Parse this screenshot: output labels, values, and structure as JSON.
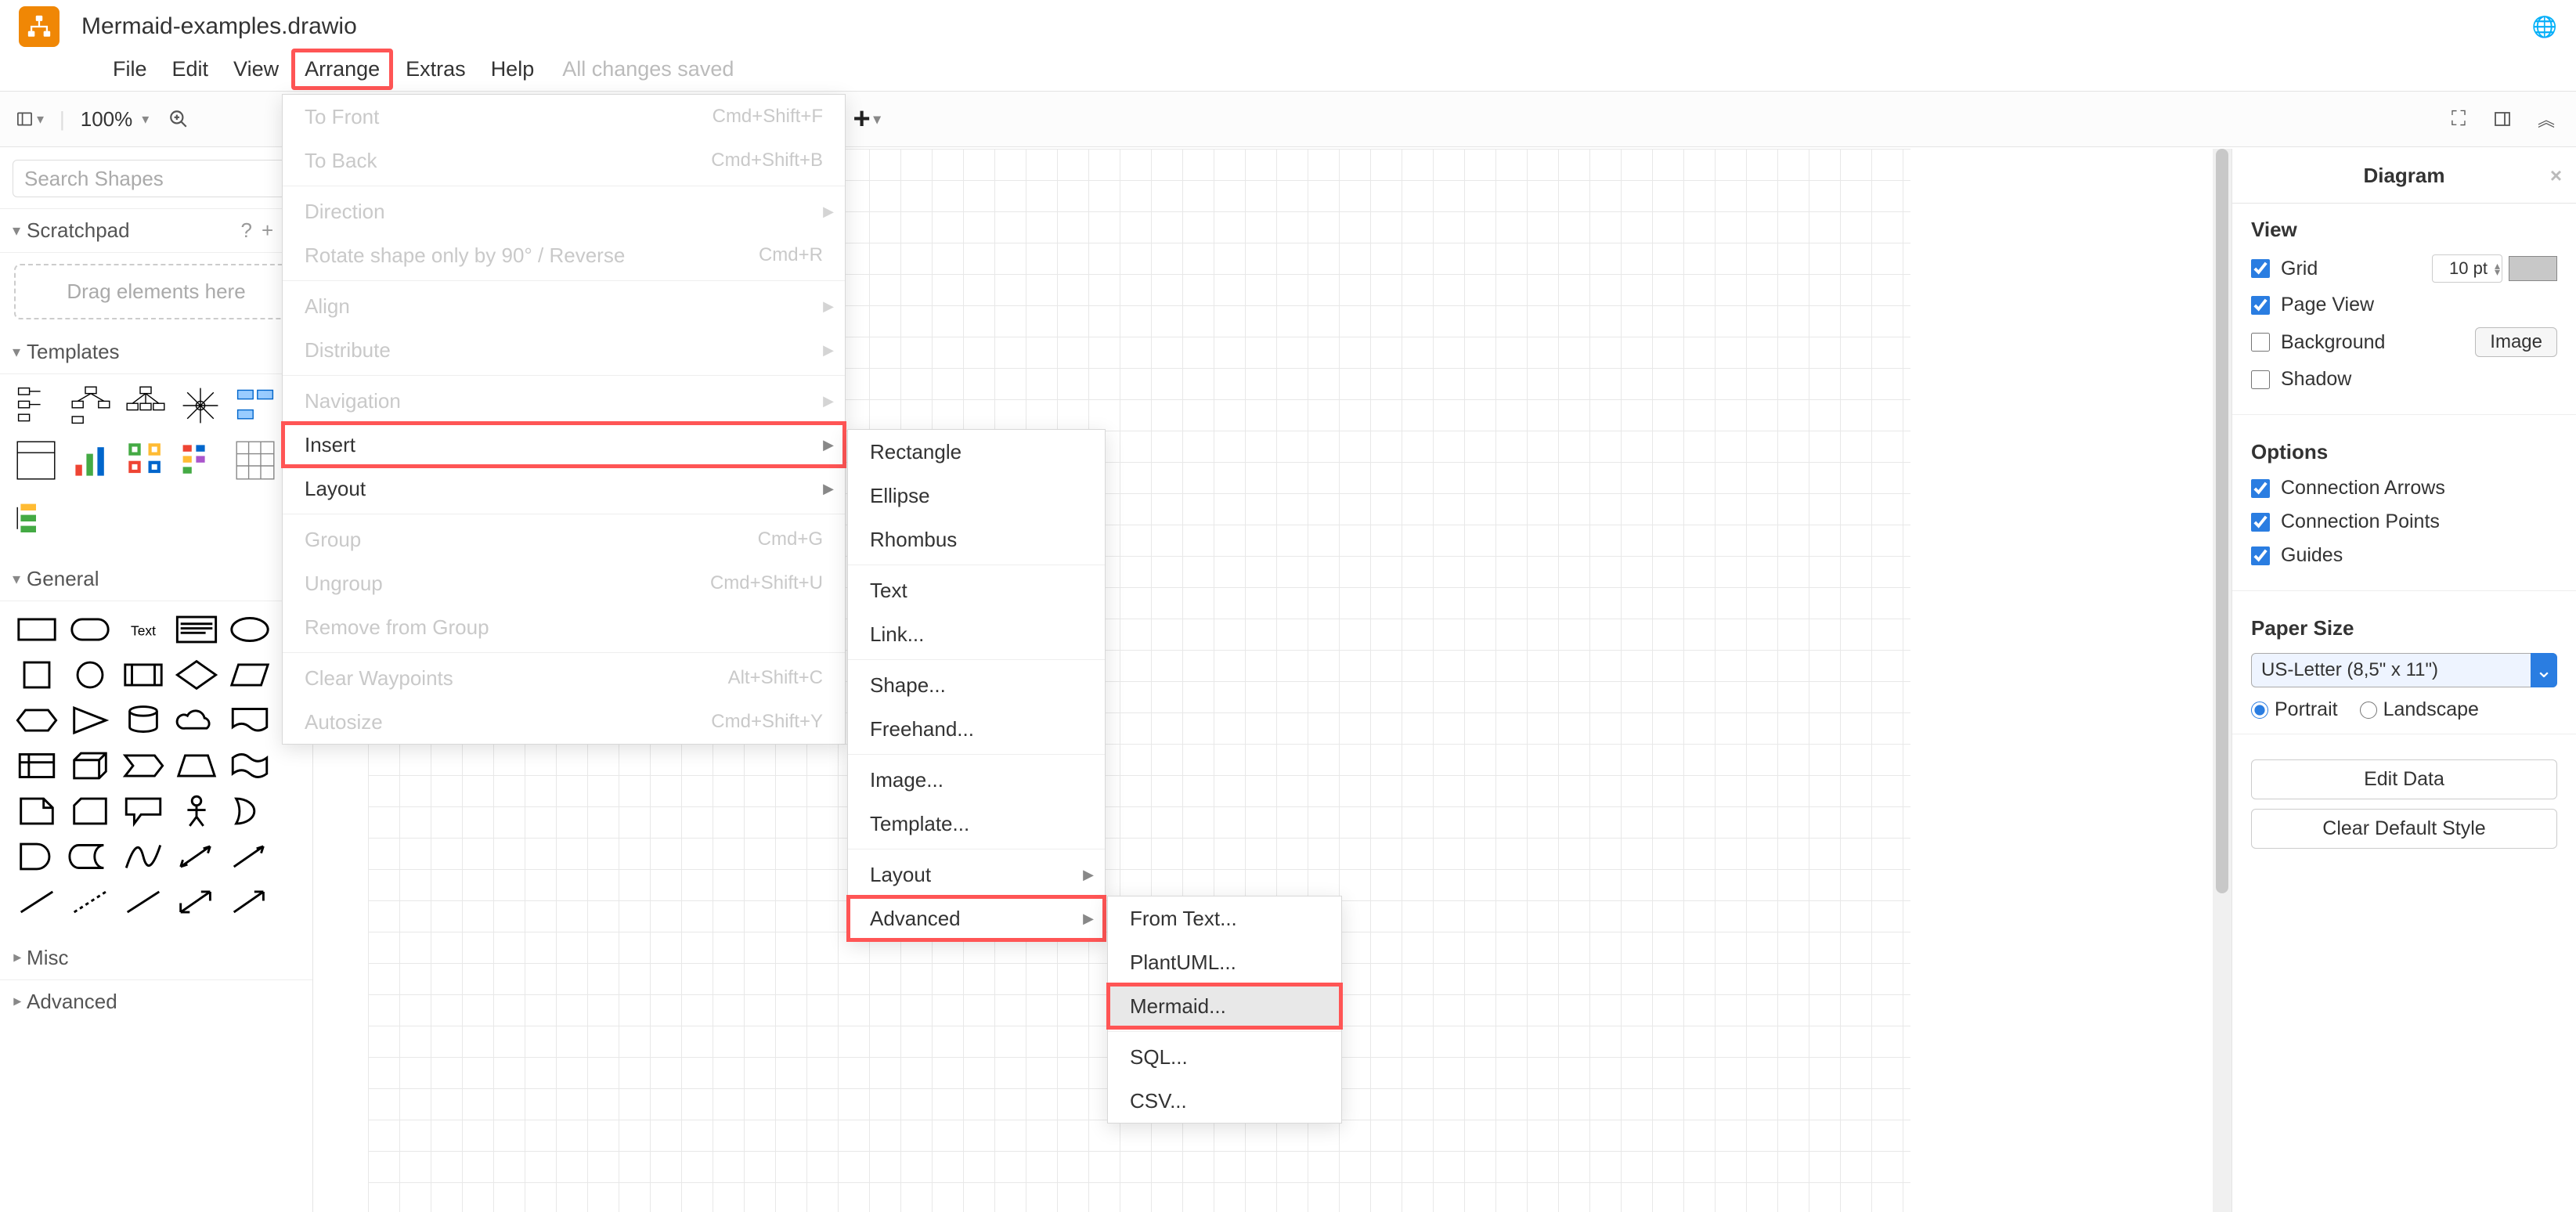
{
  "title": "Mermaid-examples.drawio",
  "menubar": {
    "items": [
      "File",
      "Edit",
      "View",
      "Arrange",
      "Extras",
      "Help"
    ],
    "highlighted": "Arrange",
    "status": "All changes saved"
  },
  "toolbar": {
    "zoom": "100%"
  },
  "left": {
    "search_placeholder": "Search Shapes",
    "scratchpad_label": "Scratchpad",
    "drag_hint": "Drag elements here",
    "templates_label": "Templates",
    "general_label": "General",
    "misc_label": "Misc",
    "advanced_label": "Advanced"
  },
  "arrange_menu": [
    {
      "label": "To Front",
      "sc": "Cmd+Shift+F",
      "disabled": true
    },
    {
      "label": "To Back",
      "sc": "Cmd+Shift+B",
      "disabled": true
    },
    {
      "sep": true
    },
    {
      "label": "Direction",
      "sub": true,
      "disabled": true
    },
    {
      "label": "Rotate shape only by 90° / Reverse",
      "sc": "Cmd+R",
      "disabled": true
    },
    {
      "sep": true
    },
    {
      "label": "Align",
      "sub": true,
      "disabled": true
    },
    {
      "label": "Distribute",
      "sub": true,
      "disabled": true
    },
    {
      "sep": true
    },
    {
      "label": "Navigation",
      "sub": true,
      "disabled": true
    },
    {
      "label": "Insert",
      "sub": true,
      "highlighted": true
    },
    {
      "label": "Layout",
      "sub": true
    },
    {
      "sep": true
    },
    {
      "label": "Group",
      "sc": "Cmd+G",
      "disabled": true
    },
    {
      "label": "Ungroup",
      "sc": "Cmd+Shift+U",
      "disabled": true
    },
    {
      "label": "Remove from Group",
      "disabled": true
    },
    {
      "sep": true
    },
    {
      "label": "Clear Waypoints",
      "sc": "Alt+Shift+C",
      "disabled": true
    },
    {
      "label": "Autosize",
      "sc": "Cmd+Shift+Y",
      "disabled": true
    }
  ],
  "insert_menu": [
    {
      "label": "Rectangle"
    },
    {
      "label": "Ellipse"
    },
    {
      "label": "Rhombus"
    },
    {
      "sep": true
    },
    {
      "label": "Text"
    },
    {
      "label": "Link..."
    },
    {
      "sep": true
    },
    {
      "label": "Shape..."
    },
    {
      "label": "Freehand..."
    },
    {
      "sep": true
    },
    {
      "label": "Image..."
    },
    {
      "label": "Template..."
    },
    {
      "sep": true
    },
    {
      "label": "Layout",
      "sub": true
    },
    {
      "label": "Advanced",
      "sub": true,
      "highlighted": true
    }
  ],
  "advanced_menu": [
    {
      "label": "From Text..."
    },
    {
      "label": "PlantUML..."
    },
    {
      "label": "Mermaid...",
      "highlighted": true,
      "hover": true
    },
    {
      "sep": true
    },
    {
      "label": "SQL..."
    },
    {
      "label": "CSV..."
    }
  ],
  "right": {
    "tab": "Diagram",
    "view_label": "View",
    "grid_label": "Grid",
    "grid_value": "10",
    "grid_unit": "pt",
    "pageview_label": "Page View",
    "background_label": "Background",
    "image_btn": "Image",
    "shadow_label": "Shadow",
    "options_label": "Options",
    "conn_arrows": "Connection Arrows",
    "conn_points": "Connection Points",
    "guides": "Guides",
    "paper_label": "Paper Size",
    "paper_value": "US-Letter (8,5\" x 11\")",
    "portrait": "Portrait",
    "landscape": "Landscape",
    "edit_data": "Edit Data",
    "clear_style": "Clear Default Style"
  }
}
